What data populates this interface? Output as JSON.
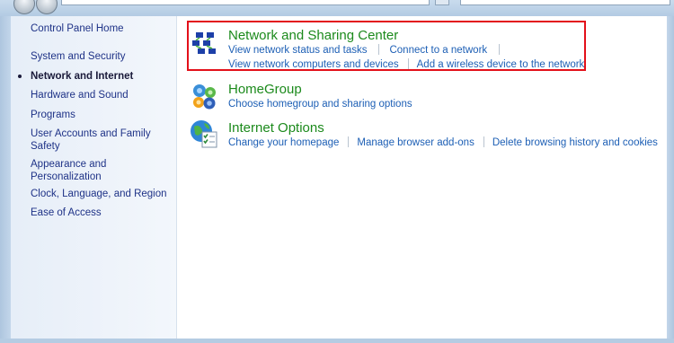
{
  "sidebar": {
    "home_label": "Control Panel Home",
    "items": [
      {
        "label": "System and Security"
      },
      {
        "label": "Network and Internet"
      },
      {
        "label": "Hardware and Sound"
      },
      {
        "label": "Programs"
      },
      {
        "label": "User Accounts and Family Safety"
      },
      {
        "label": "Appearance and Personalization"
      },
      {
        "label": "Clock, Language, and Region"
      },
      {
        "label": "Ease of Access"
      }
    ]
  },
  "categories": [
    {
      "title": "Network and Sharing Center",
      "icon": "network-icon",
      "links": [
        "View network status and tasks",
        "Connect to a network",
        "View network computers and devices",
        "Add a wireless device to the network"
      ]
    },
    {
      "title": "HomeGroup",
      "icon": "homegroup-icon",
      "links": [
        "Choose homegroup and sharing options"
      ]
    },
    {
      "title": "Internet Options",
      "icon": "internet-options-icon",
      "links": [
        "Change your homepage",
        "Manage browser add-ons",
        "Delete browsing history and cookies"
      ]
    }
  ],
  "colors": {
    "title_green": "#1c8a1c",
    "link_blue": "#1d5fb5",
    "highlight_red": "#e3101a"
  }
}
